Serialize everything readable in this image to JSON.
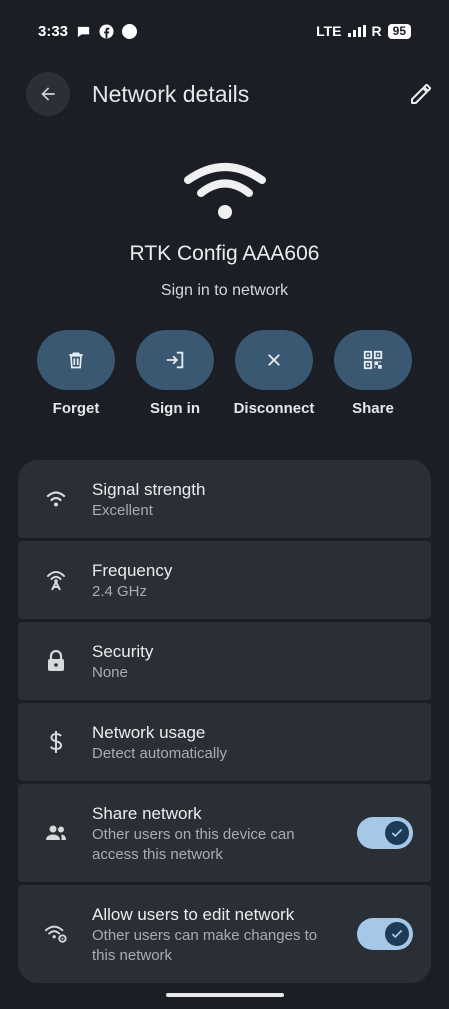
{
  "status_bar": {
    "time": "3:33",
    "network": "LTE",
    "roaming": "R",
    "battery": "95"
  },
  "app_bar": {
    "title": "Network details"
  },
  "network": {
    "name": "RTK Config AAA606",
    "status": "Sign in to network"
  },
  "actions": [
    {
      "label": "Forget",
      "icon": "trash-icon"
    },
    {
      "label": "Sign in",
      "icon": "sign-in-icon"
    },
    {
      "label": "Disconnect",
      "icon": "close-icon"
    },
    {
      "label": "Share",
      "icon": "qr-code-icon"
    }
  ],
  "details": [
    {
      "title": "Signal strength",
      "value": "Excellent",
      "icon": "wifi-signal-icon"
    },
    {
      "title": "Frequency",
      "value": "2.4 GHz",
      "icon": "antenna-icon"
    },
    {
      "title": "Security",
      "value": "None",
      "icon": "lock-icon"
    },
    {
      "title": "Network usage",
      "value": "Detect automatically",
      "icon": "dollar-icon"
    },
    {
      "title": "Share network",
      "value_line1": "Other users on this device can",
      "value_line2": "access this network",
      "icon": "people-icon",
      "toggle_on": true
    },
    {
      "title": "Allow users to edit network",
      "value_line1": "Other users can make changes to",
      "value_line2": "this network",
      "icon": "wifi-settings-icon",
      "toggle_on": true
    }
  ],
  "colors": {
    "background": "#1b1f25",
    "card": "#2a2e35",
    "accent": "#3b5873",
    "toggle_track": "#a6c8e8",
    "toggle_knob": "#1f3a55"
  }
}
